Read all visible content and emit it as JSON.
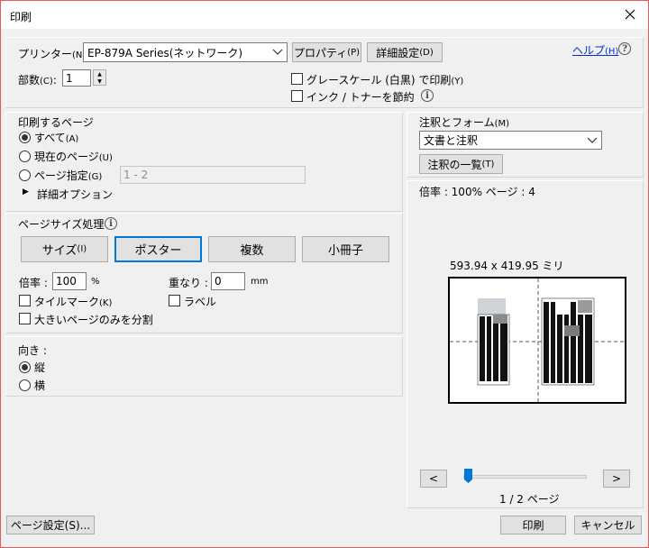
{
  "window": {
    "title": "印刷",
    "close_glyph": "✕"
  },
  "header": {
    "printer_label": "プリンター",
    "printer_key": "(N)",
    "printer_value": "EP-879A Series(ネットワーク)",
    "properties_button": "プロパティ",
    "properties_key": "(P)",
    "advanced_button": "詳細設定",
    "advanced_key": "(D)",
    "help_link": "ヘルプ",
    "help_key": "(H)",
    "copies_label": "部数",
    "copies_key": "(C)",
    "copies_colon": ":",
    "copies_value": "1",
    "grayscale_label": "グレースケール (白黒) で印刷",
    "grayscale_key": "(Y)",
    "save_ink_label": "インク / トナーを節約"
  },
  "pages_section": {
    "title": "印刷するページ",
    "all_label": "すべて",
    "all_key": "(A)",
    "current_label": "現在のページ",
    "current_key": "(U)",
    "range_label": "ページ指定",
    "range_key": "(G)",
    "range_value": "1 - 2",
    "more_options": "詳細オプション",
    "selected": "all"
  },
  "size_section": {
    "title": "ページサイズ処理",
    "buttons": [
      "サイズ",
      "ポスター",
      "複数",
      "小冊子"
    ],
    "size_key": "(I)",
    "selected": "ポスター",
    "scale_label": "倍率 :",
    "scale_value": "100",
    "scale_unit": "%",
    "overlap_label": "重なり :",
    "overlap_value": "0",
    "overlap_unit": "mm",
    "tile_marks_label": "タイルマーク",
    "tile_marks_key": "(K)",
    "labels_label": "ラベル",
    "split_large_label": "大きいページのみを分割"
  },
  "orientation_section": {
    "title": "向き :",
    "portrait": "縦",
    "landscape": "横",
    "selected": "portrait"
  },
  "comments_section": {
    "title": "注釈とフォーム",
    "title_key": "(M)",
    "select_value": "文書と注釈",
    "summary_button": "注釈の一覧",
    "summary_key": "(T)"
  },
  "preview": {
    "scale_text": "倍率 : 100% ページ : 4",
    "dimensions": "593.94 x 419.95 ミリ",
    "page_indicator": "1 / 2 ページ",
    "prev_glyph": "<",
    "next_glyph": ">",
    "slider_position": 0
  },
  "footer": {
    "page_setup": "ページ設定(S)...",
    "print": "印刷",
    "cancel": "キャンセル"
  }
}
